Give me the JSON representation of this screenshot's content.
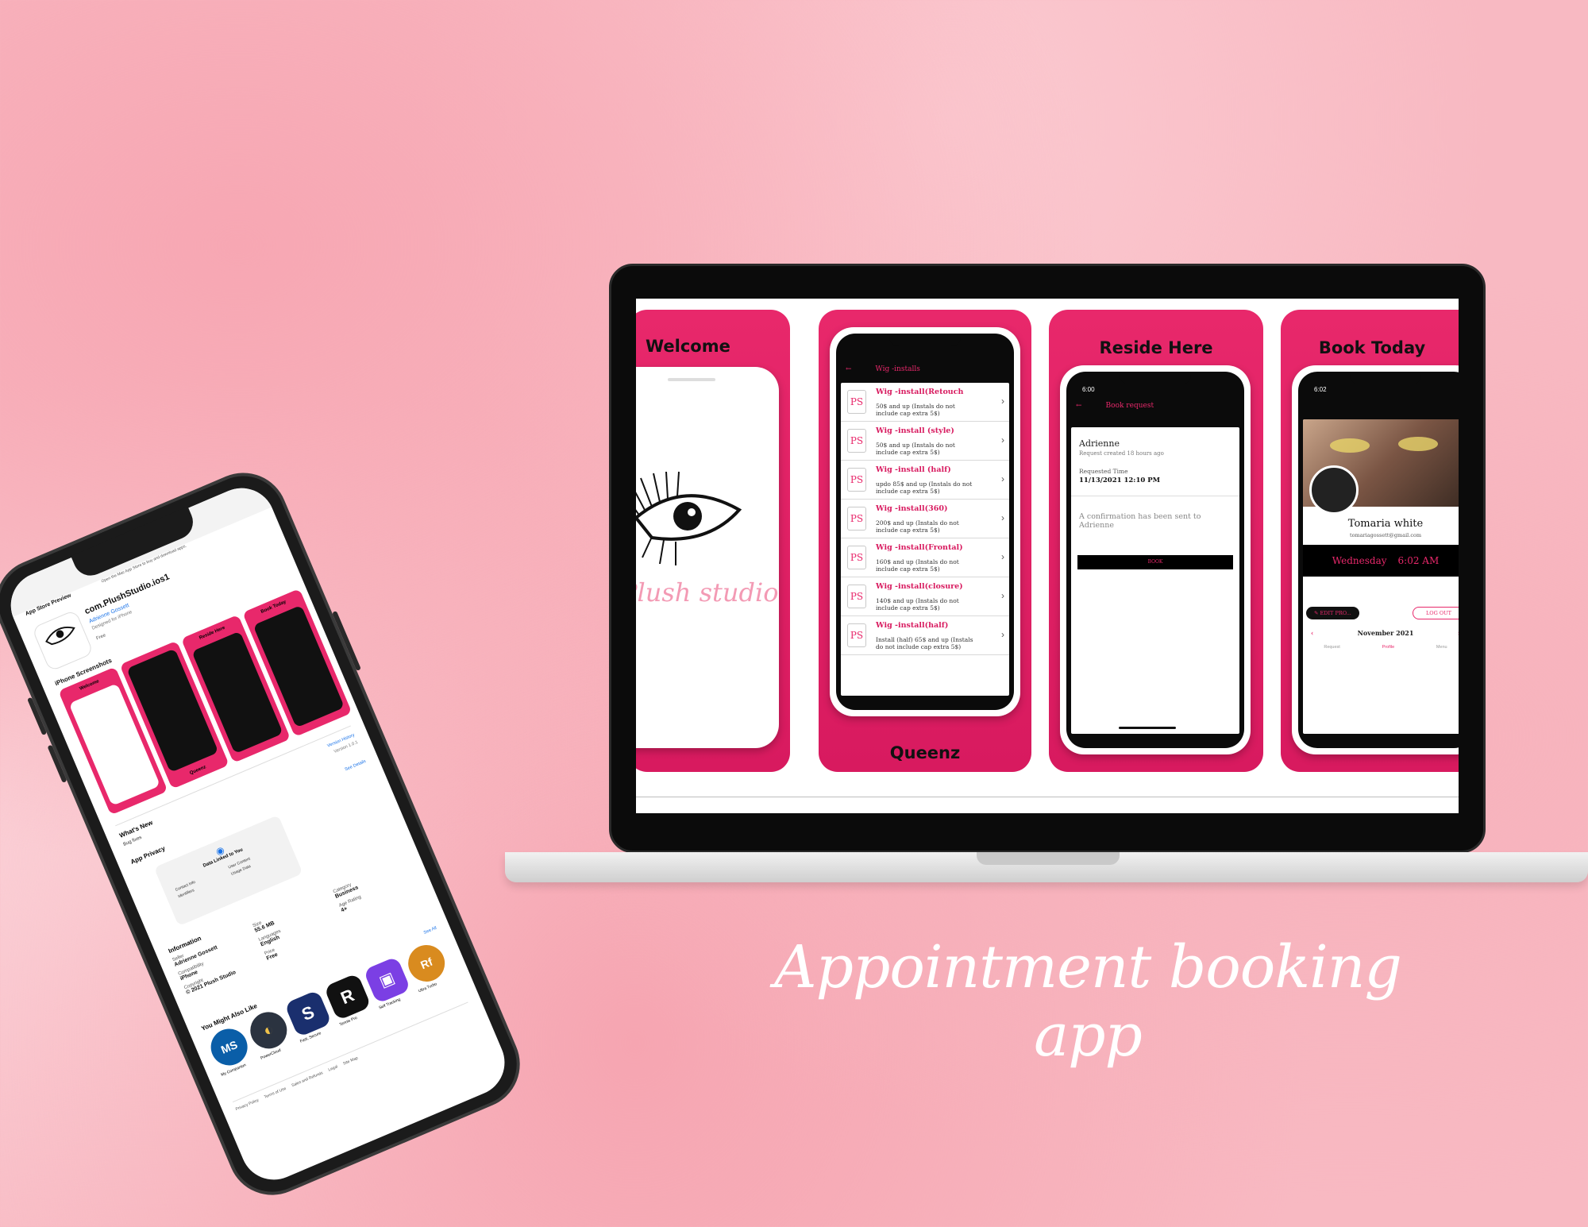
{
  "caption": "Appointment booking app",
  "laptop": {
    "panels": [
      {
        "title": "Welcome",
        "logo_text": "Plush studio"
      },
      {
        "footer": "Queenz",
        "app_bar_title": "Wig -installs",
        "items": [
          {
            "title": "Wig -install(Retouch",
            "desc": "50$ and up (Instals do not include cap extra 5$)"
          },
          {
            "title": "Wig -install (style)",
            "desc": "50$ and up (Instals do not include cap extra 5$)"
          },
          {
            "title": "Wig -install (half)",
            "desc": "updo 85$ and up (Instals do not include cap extra 5$)"
          },
          {
            "title": "Wig -install(360)",
            "desc": "200$ and up (Instals do not include cap extra 5$)"
          },
          {
            "title": "Wig -install(Frontal)",
            "desc": "160$ and up (Instals do not include cap extra 5$)"
          },
          {
            "title": "Wig -install(closure)",
            "desc": "140$ and up (Instals do not include cap extra 5$)"
          },
          {
            "title": "Wig -install(half)",
            "desc": "Install (half) 65$ and up (Instals do not include cap extra 5$)"
          }
        ]
      },
      {
        "title": "Reside Here",
        "time": "6:00",
        "app_bar_title": "Book request",
        "name": "Adrienne",
        "created": "Request created 18 hours ago",
        "requested_label": "Requested Time",
        "requested_value": "11/13/2021 12:10 PM",
        "confirmation": "A confirmation has been sent to Adrienne",
        "book_button": "BOOK"
      },
      {
        "title": "Book Today",
        "time": "6:02",
        "profile_name": "Tomaria white",
        "profile_email": "tomariagossett@gmail.com",
        "day": "Wednesday",
        "clock": "6:02 AM",
        "edit_button": "EDIT PRO...",
        "logout_button": "LOG OUT",
        "month": "November 2021",
        "nav": [
          "Request",
          "Profile",
          "Menu"
        ]
      }
    ]
  },
  "phone": {
    "breadcrumb": "App Store Preview",
    "banner": "Open the Mac App Store to buy and download apps.",
    "app_name": "com.PlushStudio.ios1",
    "developer": "Adrienne Gossett",
    "category": "Designed for iPhone",
    "price": "Free",
    "screenshots_label": "iPhone Screenshots",
    "shot_titles": [
      "Welcome",
      "Queenz",
      "Reside Here",
      "Book Today"
    ],
    "version_history": "Version History",
    "version": "Version 1.0.1",
    "whats_new": "What's New",
    "whats_new_text": "Bug fixes",
    "app_privacy": "App Privacy",
    "privacy_details": "See Details",
    "data_linked": "Data Linked to You",
    "data_items": [
      "Contact Info",
      "Identifiers",
      "User Content",
      "Usage Data"
    ],
    "information": "Information",
    "info_labels": [
      "Seller",
      "Size",
      "Category",
      "Compatibility",
      "Languages",
      "Age Rating",
      "Copyright",
      "Price"
    ],
    "info_values": [
      "Adrienne Gossett",
      "55.6 MB",
      "Business",
      "iPhone",
      "English",
      "4+",
      "© 2021 Plush Studio",
      "Free"
    ],
    "also_like": "You Might Also Like",
    "see_all": "See All",
    "apps": [
      {
        "name": "My Companion",
        "icon": "MS",
        "color": "#0a5ea8"
      },
      {
        "name": "PowerCloud",
        "icon": "◐",
        "color": "#2b3340"
      },
      {
        "name": "Fast, Secure",
        "icon": "S",
        "color": "#1a2f6e"
      },
      {
        "name": "Tennis Pro",
        "icon": "R",
        "color": "#111111"
      },
      {
        "name": "Self Tracking",
        "icon": "▣",
        "color": "#7b3fe4"
      },
      {
        "name": "Ultra Turbo",
        "icon": "Rf",
        "color": "#d98b1f"
      }
    ],
    "footer_links": [
      "Privacy Policy",
      "Terms of Use",
      "Sales and Refunds",
      "Legal",
      "Site Map"
    ]
  }
}
